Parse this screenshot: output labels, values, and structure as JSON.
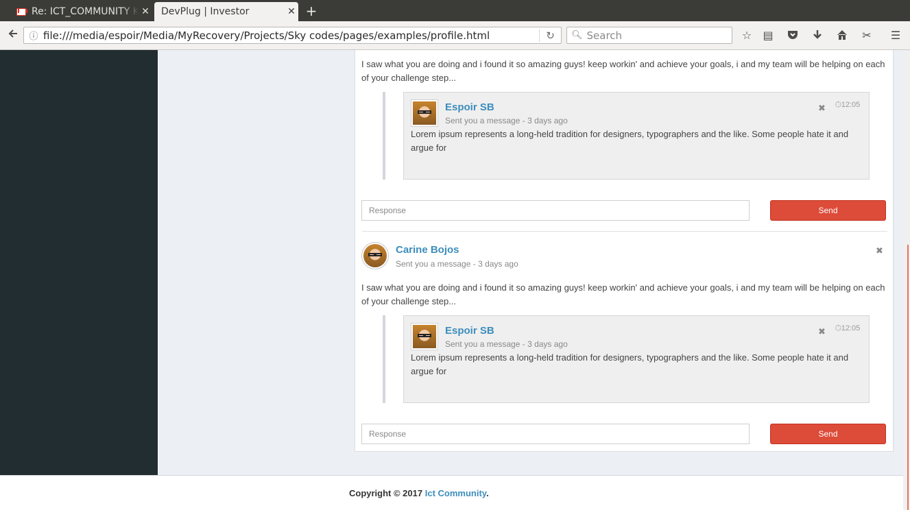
{
  "browser": {
    "tabs": [
      {
        "title": "Re: ICT_COMMUNITY K",
        "active": false
      },
      {
        "title": "DevPlug | Investor",
        "active": true
      }
    ],
    "url": "file:///media/espoir/Media/MyRecovery/Projects/Sky codes/pages/examples/profile.html",
    "search_placeholder": "Search"
  },
  "thread_top": {
    "message": "I saw what you are doing and i found it so amazing guys! keep workin' and achieve your goals, i and my team will be helping on each of your challenge step...",
    "reply": {
      "author": "Espoir SB",
      "meta": "Sent you a message - 3 days ago",
      "time": "12:05",
      "text": "Lorem ipsum represents a long-held tradition for designers, typographers and the like. Some people hate it and argue for"
    },
    "response_placeholder": "Response",
    "send_label": "Send"
  },
  "thread_bottom": {
    "author": "Carine Bojos",
    "meta": "Sent you a message - 3 days ago",
    "message": "I saw what you are doing and i found it so amazing guys! keep workin' and achieve your goals, i and my team will be helping on each of your challenge step...",
    "reply": {
      "author": "Espoir SB",
      "meta": "Sent you a message - 3 days ago",
      "time": "12:05",
      "text": "Lorem ipsum represents a long-held tradition for designers, typographers and the like. Some people hate it and argue for"
    },
    "response_placeholder": "Response",
    "send_label": "Send"
  },
  "footer": {
    "copyright": "Copyright © 2017",
    "link": "Ict Community",
    "period": "."
  },
  "colors": {
    "sidebar": "#222d32",
    "link": "#3c8dbc",
    "send": "#dd4b39"
  }
}
